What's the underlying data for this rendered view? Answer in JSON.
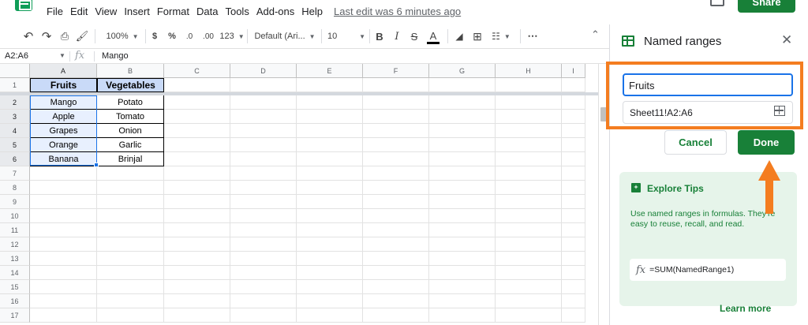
{
  "menu": {
    "items": [
      "File",
      "Edit",
      "View",
      "Insert",
      "Format",
      "Data",
      "Tools",
      "Add-ons",
      "Help"
    ],
    "last_edit": "Last edit was 6 minutes ago",
    "share_label": "Share"
  },
  "toolbar": {
    "zoom": "100%",
    "currency": "$",
    "percent": "%",
    "decimal_decrease": ".0",
    "decimal_increase": ".00",
    "more_formats": "123",
    "font": "Default (Ari...",
    "font_size": "10",
    "bold": "B",
    "italic": "I",
    "strike": "S",
    "text_color": "A",
    "more": "⋯"
  },
  "formula_bar": {
    "name_box": "A2:A6",
    "fx": "fx",
    "value": "Mango"
  },
  "grid": {
    "columns": [
      "A",
      "B",
      "C",
      "D",
      "E",
      "F",
      "G",
      "H",
      "I"
    ],
    "rows": [
      "1",
      "2",
      "3",
      "4",
      "5",
      "6",
      "7",
      "8",
      "9",
      "10",
      "11",
      "12",
      "13",
      "14",
      "15",
      "16",
      "17"
    ],
    "headers": [
      "Fruits",
      "Vegetables"
    ],
    "data": [
      [
        "Mango",
        "Potato"
      ],
      [
        "Apple",
        "Tomato"
      ],
      [
        "Grapes",
        "Onion"
      ],
      [
        "Orange",
        "Garlic"
      ],
      [
        "Banana",
        "Brinjal"
      ]
    ]
  },
  "panel": {
    "title": "Named ranges",
    "name_value": "Fruits",
    "range_value": "Sheet11!A2:A6",
    "cancel_label": "Cancel",
    "done_label": "Done",
    "tips_title": "Explore Tips",
    "tips_body": "Use named ranges in formulas. They're easy to reuse, recall, and read.",
    "tips_fx": "fx",
    "tips_formula": "=SUM(NamedRange1)",
    "learn_more": "Learn more"
  },
  "colors": {
    "brand_green": "#188038",
    "selection_blue": "#1a73e8",
    "header_fill": "#c9daf8",
    "annotation_orange": "#f47d20"
  }
}
